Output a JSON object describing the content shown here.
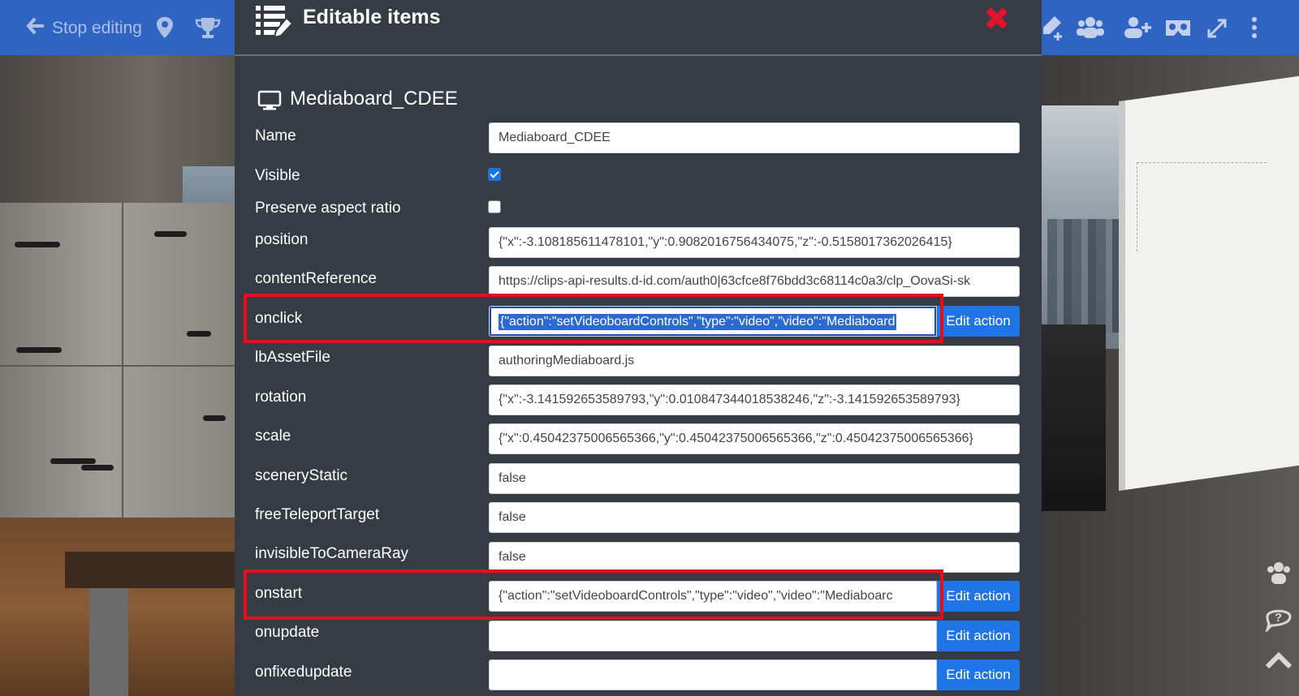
{
  "topbar": {
    "stop_editing_label": "Stop editing",
    "left_icons": [
      "arrow-left-icon",
      "map-pin-icon",
      "trophy-icon"
    ],
    "right_icons": [
      "edit-add-icon",
      "users-icon",
      "add-user-icon",
      "vr-headset-icon",
      "expand-icon",
      "more-vertical-icon"
    ]
  },
  "modal": {
    "title": "Editable items",
    "close_symbol": "✖",
    "item_name": "Mediaboard_CDEE",
    "edit_action_label": "Edit action",
    "fields": {
      "name": {
        "label": "Name",
        "value": "Mediaboard_CDEE"
      },
      "visible": {
        "label": "Visible",
        "checked": true
      },
      "preserve": {
        "label": "Preserve aspect ratio",
        "checked": false
      },
      "position": {
        "label": "position",
        "value": "{\"x\":-3.108185611478101,\"y\":0.9082016756434075,\"z\":-0.5158017362026415}"
      },
      "content_reference": {
        "label": "contentReference",
        "value": "https://clips-api-results.d-id.com/auth0|63cfce8f76bdd3c68114c0a3/clp_OovaSi-sk"
      },
      "onclick": {
        "label": "onclick",
        "value": "{\"action\":\"setVideoboardControls\",\"type\":\"video\",\"video\":\"Mediaboard"
      },
      "lb_asset_file": {
        "label": "lbAssetFile",
        "value": "authoringMediaboard.js"
      },
      "rotation": {
        "label": "rotation",
        "value": "{\"x\":-3.141592653589793,\"y\":0.010847344018538246,\"z\":-3.141592653589793}"
      },
      "scale": {
        "label": "scale",
        "value": "{\"x\":0.45042375006565366,\"y\":0.45042375006565366,\"z\":0.45042375006565366}"
      },
      "scenery_static": {
        "label": "sceneryStatic",
        "value": "false"
      },
      "free_teleport_target": {
        "label": "freeTeleportTarget",
        "value": "false"
      },
      "invisible_to_camera_ray": {
        "label": "invisibleToCameraRay",
        "value": "false"
      },
      "onstart": {
        "label": "onstart",
        "value": "{\"action\":\"setVideoboardControls\",\"type\":\"video\",\"video\":\"Mediaboarc"
      },
      "onupdate": {
        "label": "onupdate",
        "value": ""
      },
      "onfixedupdate": {
        "label": "onfixedupdate",
        "value": ""
      }
    }
  },
  "colors": {
    "topbar": "#2f64c3",
    "modal_bg": "#363b44",
    "button_blue": "#1f74e6",
    "close_red": "#e0142a",
    "highlight_red": "#e3101c",
    "selection_blue": "#2c6ad3"
  }
}
